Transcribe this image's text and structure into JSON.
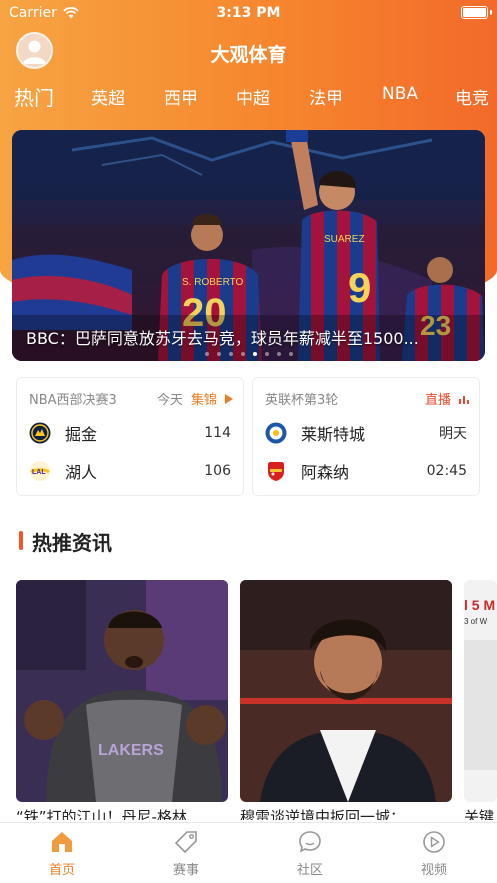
{
  "status_bar": {
    "carrier": "Carrier",
    "time": "3:13 PM"
  },
  "header": {
    "title": "大观体育"
  },
  "tabs": [
    {
      "label": "热门",
      "active": true
    },
    {
      "label": "英超"
    },
    {
      "label": "西甲"
    },
    {
      "label": "中超"
    },
    {
      "label": "法甲"
    },
    {
      "label": "NBA"
    },
    {
      "label": "电竞"
    }
  ],
  "banner": {
    "caption": "BBC：巴萨同意放苏牙去马竞，球员年薪减半至1500...",
    "page_count": 8,
    "active_index": 4,
    "jersey_left": "S. ROBERTO",
    "jersey_left_number": "20",
    "jersey_right": "SUAREZ",
    "jersey_right_number": "9",
    "jersey_far": "23"
  },
  "matches": [
    {
      "league": "NBA西部决赛3",
      "day": "今天",
      "tag": "集锦",
      "teams": [
        {
          "name": "掘金",
          "value": "114",
          "logo_color": "#0e2240"
        },
        {
          "name": "湖人",
          "value": "106",
          "logo_color": "#f5c324"
        }
      ]
    },
    {
      "league": "英联杯第3轮",
      "tag": "直播",
      "teams": [
        {
          "name": "莱斯特城",
          "value": "明天",
          "logo_color": "#1d58a8"
        },
        {
          "name": "阿森纳",
          "value": "02:45",
          "logo_color": "#d8201f"
        }
      ]
    }
  ],
  "section": {
    "title": "热推资讯"
  },
  "news": [
    {
      "title": "“铁”打的江山！丹尼-格林..."
    },
    {
      "title": "穆雷谈逆境中扳回一城：..."
    },
    {
      "title": "关键",
      "image_text_1": "l 5 M",
      "image_text_2": "3 of W"
    }
  ],
  "tab_bar": [
    {
      "label": "首页",
      "icon": "home-icon",
      "active": true
    },
    {
      "label": "赛事",
      "icon": "tag-icon"
    },
    {
      "label": "社区",
      "icon": "chat-icon"
    },
    {
      "label": "视频",
      "icon": "play-icon"
    }
  ],
  "colors": {
    "accent": "#f07c22",
    "gradient_start": "#f7a443",
    "gradient_end": "#f26a2a"
  }
}
